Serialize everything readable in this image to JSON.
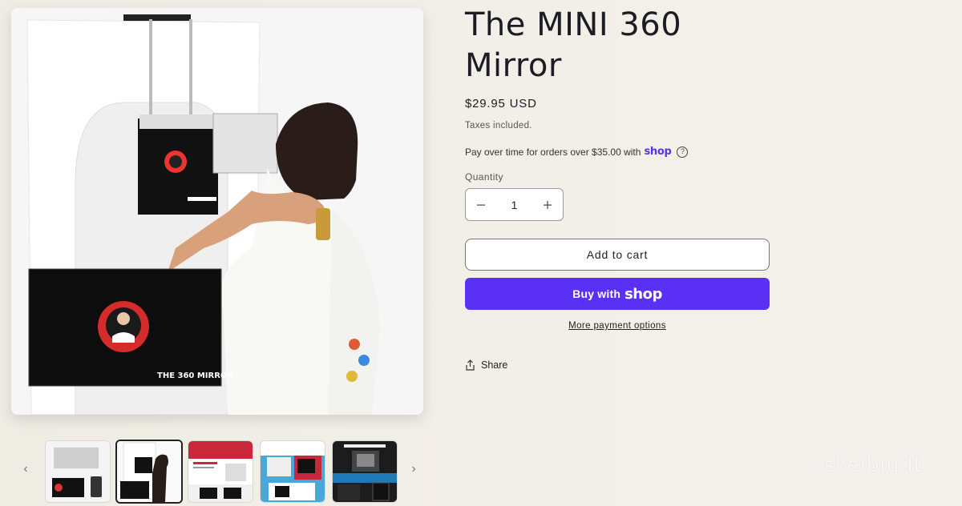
{
  "product": {
    "title": "The MINI 360 Mirror",
    "price": "$29.95 USD",
    "tax_note": "Taxes included.",
    "installments_text": "Pay over time for orders over $35.00 with",
    "installments_brand": "shop",
    "quantity_label": "Quantity",
    "quantity_value": "1",
    "add_to_cart_label": "Add to cart",
    "buy_with_label": "Buy with",
    "buy_with_brand": "shop",
    "more_payment_label": "More payment options",
    "share_label": "Share"
  },
  "media": {
    "main_logo_text": "THE 360 MIRROR",
    "thumbnails_count": 5,
    "active_thumbnail": 2,
    "prev_arrow": "‹",
    "next_arrow": "›"
  },
  "icons": {
    "minus": "minus-icon",
    "plus": "plus-icon",
    "share": "share-icon",
    "help": "question-circle-icon"
  },
  "colors": {
    "shop_purple": "#5a31f4",
    "text": "#1c1c24"
  },
  "watermark": "skelbiu.lt"
}
